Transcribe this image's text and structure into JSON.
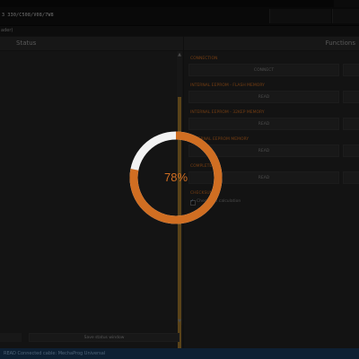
{
  "toolbar": {
    "path_text": "3 330/C508/V08/7W8"
  },
  "breadcrumb": {
    "text": "ader)"
  },
  "status_panel": {
    "header": "Status",
    "save_button": "Save status window"
  },
  "functions_panel": {
    "header": "Functions",
    "sections": [
      {
        "label": "CONNECTION",
        "button": "CONNECT"
      },
      {
        "label": "INTERNAL EEPROM - FLASH MEMORY",
        "button": "READ"
      },
      {
        "label": "INTERNAL EEPROM - 32KEP MEMORY",
        "button": "READ"
      },
      {
        "label": "EXTERNAL EEPROM MEMORY",
        "button": "READ"
      },
      {
        "label": "COMPLETE",
        "button": "READ"
      }
    ],
    "checksum": {
      "label": "CHECKSUM",
      "checkbox_label": "Checksum calculation",
      "checked": true
    }
  },
  "statusbar": {
    "text": "READ  Connected cable: MechaProg Universal"
  },
  "progress": {
    "percent": 78,
    "label": "78%",
    "ring_color": "#d06e22",
    "remainder_color": "#f2f2f2"
  },
  "colors": {
    "accent": "#d06e22",
    "scrollbar": "#a57a2e",
    "statusbar_bg": "#1a3b5e"
  }
}
